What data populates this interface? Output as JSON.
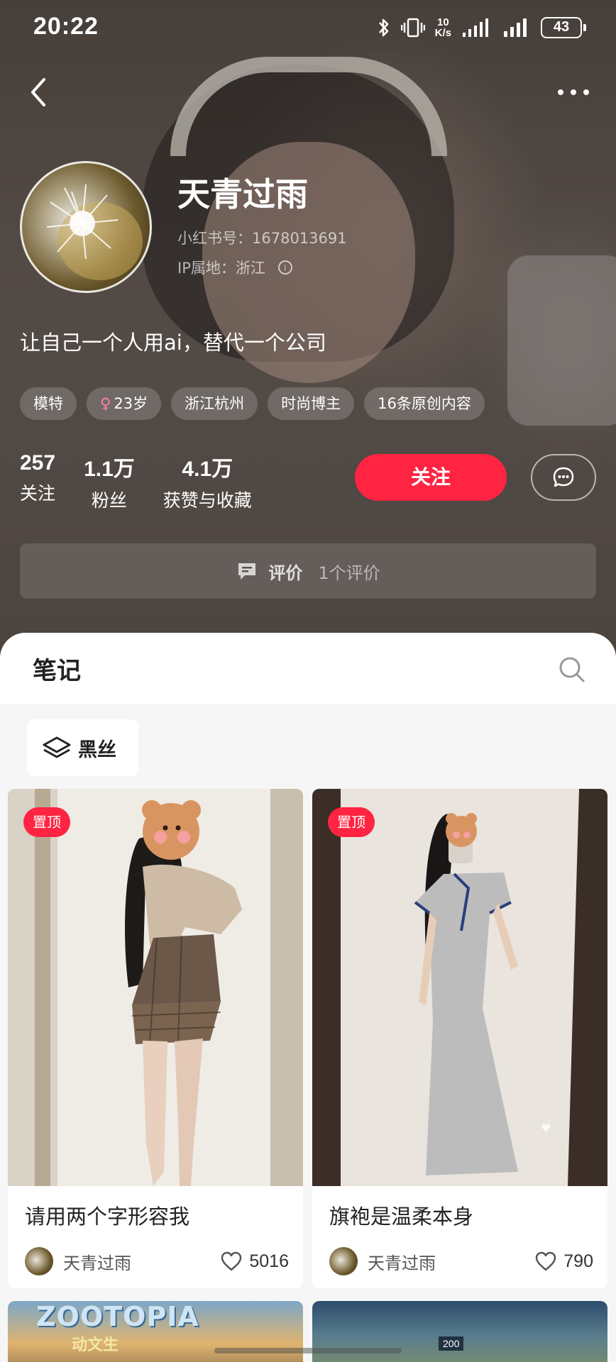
{
  "status_bar": {
    "time": "20:22",
    "net_speed_value": "10",
    "net_speed_unit": "K/s",
    "battery": "43",
    "icons": [
      "bluetooth-icon",
      "vibrate-icon",
      "signal-icon",
      "signal-icon"
    ]
  },
  "nav": {
    "back_icon": "chevron-left-icon",
    "more_icon": "more-dots-icon"
  },
  "profile": {
    "nickname": "天青过雨",
    "red_id": "小红书号：1678013691",
    "ip_location": "IP属地：浙江",
    "bio": "让自己一个人用ai，替代一个公司",
    "tags": [
      {
        "label": "模特"
      },
      {
        "label": "23岁",
        "gender_symbol": "♀"
      },
      {
        "label": "浙江杭州"
      },
      {
        "label": "时尚博主"
      },
      {
        "label": "16条原创内容"
      }
    ],
    "stats": [
      {
        "value": "257",
        "label": "关注"
      },
      {
        "value": "1.1万",
        "label": "粉丝"
      },
      {
        "value": "4.1万",
        "label": "获赞与收藏"
      }
    ],
    "follow_label": "关注",
    "review_label": "评价",
    "review_count": "1个评价"
  },
  "notes": {
    "tab_title": "笔记",
    "collection": "黑丝",
    "cards": [
      {
        "pinned_label": "置顶",
        "title": "请用两个字形容我",
        "author": "天青过雨",
        "likes": "5016"
      },
      {
        "pinned_label": "置顶",
        "title": "旗袍是温柔本身",
        "author": "天青过雨",
        "likes": "790"
      }
    ],
    "peek_card_left": {
      "logo_text": "ZOOTOPIA",
      "logo_subtext": "动文生"
    },
    "peek_card_right": {
      "bus_number": "200"
    }
  },
  "colors": {
    "accent": "#ff2442",
    "header_bg": "#5a514b",
    "sheet_bg": "#f6f6f6"
  }
}
